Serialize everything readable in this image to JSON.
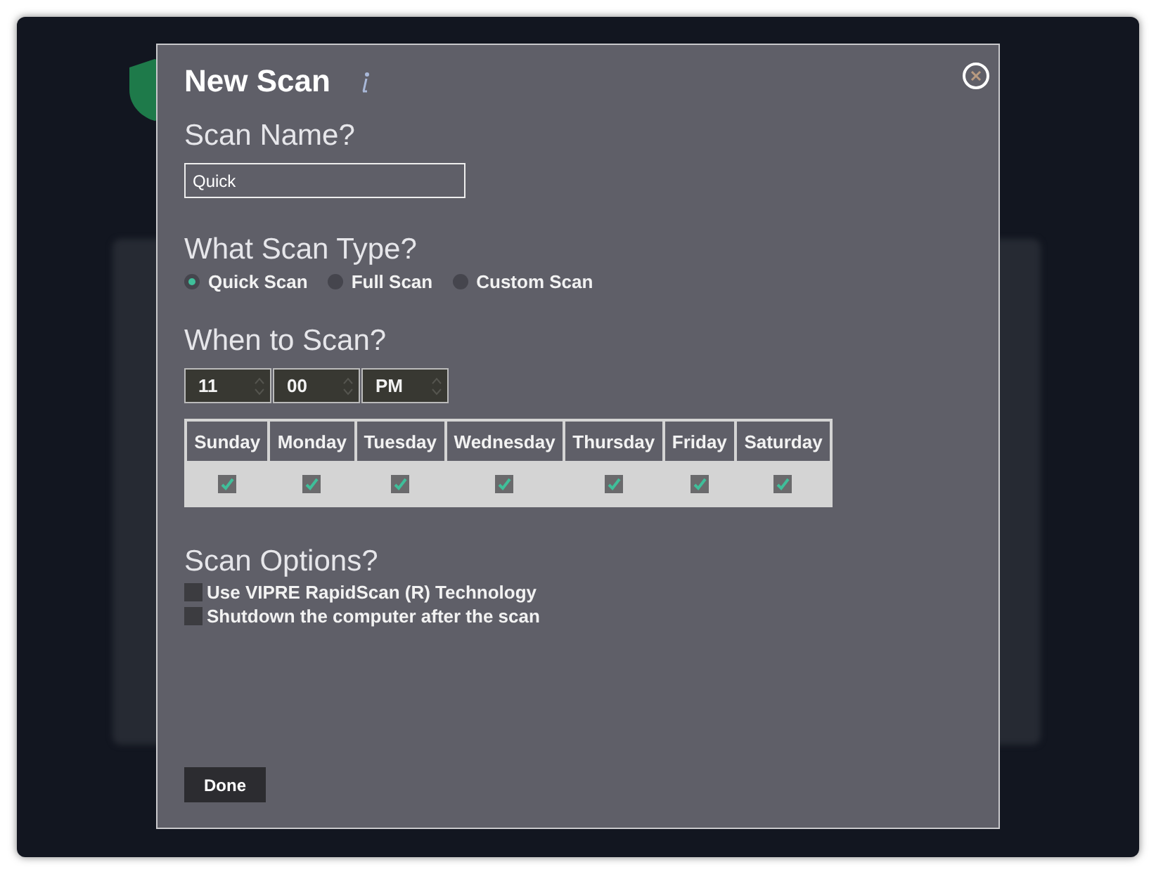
{
  "dialog": {
    "title": "New Scan",
    "done_label": "Done"
  },
  "scan_name": {
    "heading": "Scan Name?",
    "value": "Quick"
  },
  "scan_type": {
    "heading": "What Scan Type?",
    "options": [
      {
        "label": "Quick Scan",
        "selected": true
      },
      {
        "label": "Full Scan",
        "selected": false
      },
      {
        "label": "Custom Scan",
        "selected": false
      }
    ]
  },
  "schedule": {
    "heading": "When to Scan?",
    "time": [
      {
        "value": "11"
      },
      {
        "value": "00"
      },
      {
        "value": "PM"
      }
    ],
    "days": [
      {
        "label": "Sunday",
        "checked": true
      },
      {
        "label": "Monday",
        "checked": true
      },
      {
        "label": "Tuesday",
        "checked": true
      },
      {
        "label": "Wednesday",
        "checked": true
      },
      {
        "label": "Thursday",
        "checked": true
      },
      {
        "label": "Friday",
        "checked": true
      },
      {
        "label": "Saturday",
        "checked": true
      }
    ]
  },
  "scan_options": {
    "heading": "Scan Options?",
    "items": [
      {
        "label": "Use VIPRE RapidScan (R) Technology",
        "checked": false
      },
      {
        "label": "Shutdown the computer after the scan",
        "checked": false
      }
    ]
  }
}
